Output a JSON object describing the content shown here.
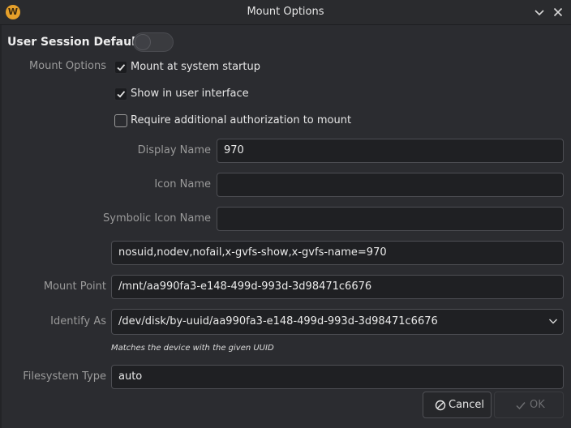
{
  "window": {
    "title": "Mount Options",
    "icon": "w-logo-icon",
    "minimize_icon": "chevron-down-icon",
    "close_icon": "close-icon"
  },
  "session": {
    "heading": "User Session Defaults",
    "toggle_on": false
  },
  "mount_options": {
    "label": "Mount Options",
    "startup": {
      "label": "Mount at system startup",
      "checked": true
    },
    "show_ui": {
      "label": "Show in user interface",
      "checked": true
    },
    "auth": {
      "label": "Require additional authorization to mount",
      "checked": false
    }
  },
  "fields": {
    "display_name": {
      "label": "Display Name",
      "value": "970"
    },
    "icon_name": {
      "label": "Icon Name",
      "value": ""
    },
    "symbolic_icon_name": {
      "label": "Symbolic Icon Name",
      "value": ""
    },
    "options": {
      "value": "nosuid,nodev,nofail,x-gvfs-show,x-gvfs-name=970"
    },
    "mount_point": {
      "label": "Mount Point",
      "value": "/mnt/aa990fa3-e148-499d-993d-3d98471c6676"
    },
    "identify_as": {
      "label": "Identify As",
      "value": "/dev/disk/by-uuid/aa990fa3-e148-499d-993d-3d98471c6676",
      "hint": "Matches the device with the given UUID"
    },
    "filesystem_type": {
      "label": "Filesystem Type",
      "value": "auto"
    }
  },
  "buttons": {
    "cancel": "Cancel",
    "ok": "OK"
  },
  "colors": {
    "background": "#2b2c30",
    "field_bg": "#1f2023",
    "accent_logo": "#e6a02a"
  }
}
